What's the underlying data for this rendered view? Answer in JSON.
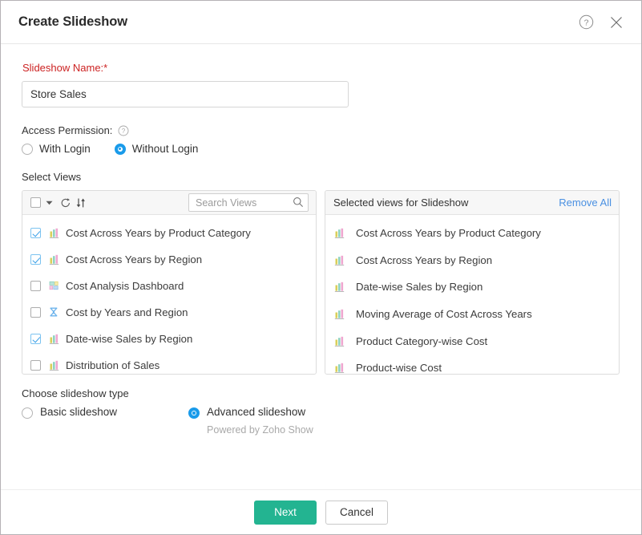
{
  "dialog": {
    "title": "Create Slideshow",
    "help_icon": "help-circle-icon",
    "close_icon": "close-icon"
  },
  "form": {
    "name_label": "Slideshow Name:*",
    "name_value": "Store Sales",
    "name_placeholder": "",
    "access_label": "Access Permission:",
    "access_help_icon": "help-circle-icon",
    "access_options": [
      {
        "label": "With Login",
        "selected": false
      },
      {
        "label": "Without Login",
        "selected": true
      }
    ]
  },
  "select_views": {
    "section_label": "Select Views",
    "toolbar": {
      "select_all_checked": false,
      "dropdown_icon": "chevron-down-icon",
      "refresh_icon": "refresh-icon",
      "sort_icon": "sort-icon",
      "search_placeholder": "Search Views",
      "search_value": "",
      "search_icon": "search-icon"
    },
    "items": [
      {
        "label": "Cost Across Years by Product Category",
        "checked": true,
        "icon": "bar-chart-icon"
      },
      {
        "label": "Cost Across Years by Region",
        "checked": true,
        "icon": "bar-chart-icon"
      },
      {
        "label": "Cost Analysis Dashboard",
        "checked": false,
        "icon": "dashboard-icon"
      },
      {
        "label": "Cost by Years and Region",
        "checked": false,
        "icon": "pivot-table-icon"
      },
      {
        "label": "Date-wise Sales by Region",
        "checked": true,
        "icon": "bar-chart-icon"
      },
      {
        "label": "Distribution of Sales",
        "checked": false,
        "icon": "bar-chart-icon"
      }
    ]
  },
  "selected_views": {
    "header": "Selected views for Slideshow",
    "remove_all": "Remove All",
    "items": [
      {
        "label": "Cost Across Years by Product Category",
        "icon": "bar-chart-icon"
      },
      {
        "label": "Cost Across Years by Region",
        "icon": "bar-chart-icon"
      },
      {
        "label": "Date-wise Sales by Region",
        "icon": "bar-chart-icon"
      },
      {
        "label": "Moving Average of Cost Across Years",
        "icon": "bar-chart-icon"
      },
      {
        "label": "Product Category-wise Cost",
        "icon": "bar-chart-icon"
      },
      {
        "label": "Product-wise Cost",
        "icon": "bar-chart-icon"
      }
    ]
  },
  "slideshow_type": {
    "label": "Choose slideshow type",
    "options": [
      {
        "label": "Basic slideshow",
        "selected": false,
        "note": ""
      },
      {
        "label": "Advanced slideshow",
        "selected": true,
        "note": "Powered by Zoho Show"
      }
    ]
  },
  "footer": {
    "next_label": "Next",
    "cancel_label": "Cancel"
  },
  "colors": {
    "required_label": "#cc2222",
    "link": "#4a90e2",
    "radio_accent": "#1a9bea",
    "checkbox_accent": "#3aa0e8",
    "primary_button": "#23b491"
  }
}
